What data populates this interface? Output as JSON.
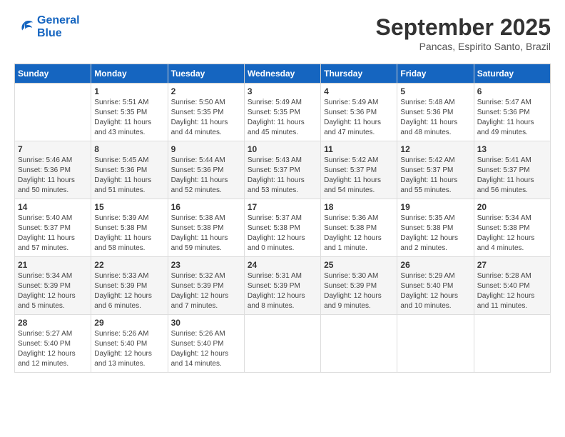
{
  "header": {
    "logo_line1": "General",
    "logo_line2": "Blue",
    "month_title": "September 2025",
    "location": "Pancas, Espirito Santo, Brazil"
  },
  "calendar": {
    "days_of_week": [
      "Sunday",
      "Monday",
      "Tuesday",
      "Wednesday",
      "Thursday",
      "Friday",
      "Saturday"
    ],
    "weeks": [
      [
        {
          "day": "",
          "info": ""
        },
        {
          "day": "1",
          "info": "Sunrise: 5:51 AM\nSunset: 5:35 PM\nDaylight: 11 hours\nand 43 minutes."
        },
        {
          "day": "2",
          "info": "Sunrise: 5:50 AM\nSunset: 5:35 PM\nDaylight: 11 hours\nand 44 minutes."
        },
        {
          "day": "3",
          "info": "Sunrise: 5:49 AM\nSunset: 5:35 PM\nDaylight: 11 hours\nand 45 minutes."
        },
        {
          "day": "4",
          "info": "Sunrise: 5:49 AM\nSunset: 5:36 PM\nDaylight: 11 hours\nand 47 minutes."
        },
        {
          "day": "5",
          "info": "Sunrise: 5:48 AM\nSunset: 5:36 PM\nDaylight: 11 hours\nand 48 minutes."
        },
        {
          "day": "6",
          "info": "Sunrise: 5:47 AM\nSunset: 5:36 PM\nDaylight: 11 hours\nand 49 minutes."
        }
      ],
      [
        {
          "day": "7",
          "info": "Sunrise: 5:46 AM\nSunset: 5:36 PM\nDaylight: 11 hours\nand 50 minutes."
        },
        {
          "day": "8",
          "info": "Sunrise: 5:45 AM\nSunset: 5:36 PM\nDaylight: 11 hours\nand 51 minutes."
        },
        {
          "day": "9",
          "info": "Sunrise: 5:44 AM\nSunset: 5:36 PM\nDaylight: 11 hours\nand 52 minutes."
        },
        {
          "day": "10",
          "info": "Sunrise: 5:43 AM\nSunset: 5:37 PM\nDaylight: 11 hours\nand 53 minutes."
        },
        {
          "day": "11",
          "info": "Sunrise: 5:42 AM\nSunset: 5:37 PM\nDaylight: 11 hours\nand 54 minutes."
        },
        {
          "day": "12",
          "info": "Sunrise: 5:42 AM\nSunset: 5:37 PM\nDaylight: 11 hours\nand 55 minutes."
        },
        {
          "day": "13",
          "info": "Sunrise: 5:41 AM\nSunset: 5:37 PM\nDaylight: 11 hours\nand 56 minutes."
        }
      ],
      [
        {
          "day": "14",
          "info": "Sunrise: 5:40 AM\nSunset: 5:37 PM\nDaylight: 11 hours\nand 57 minutes."
        },
        {
          "day": "15",
          "info": "Sunrise: 5:39 AM\nSunset: 5:38 PM\nDaylight: 11 hours\nand 58 minutes."
        },
        {
          "day": "16",
          "info": "Sunrise: 5:38 AM\nSunset: 5:38 PM\nDaylight: 11 hours\nand 59 minutes."
        },
        {
          "day": "17",
          "info": "Sunrise: 5:37 AM\nSunset: 5:38 PM\nDaylight: 12 hours\nand 0 minutes."
        },
        {
          "day": "18",
          "info": "Sunrise: 5:36 AM\nSunset: 5:38 PM\nDaylight: 12 hours\nand 1 minute."
        },
        {
          "day": "19",
          "info": "Sunrise: 5:35 AM\nSunset: 5:38 PM\nDaylight: 12 hours\nand 2 minutes."
        },
        {
          "day": "20",
          "info": "Sunrise: 5:34 AM\nSunset: 5:38 PM\nDaylight: 12 hours\nand 4 minutes."
        }
      ],
      [
        {
          "day": "21",
          "info": "Sunrise: 5:34 AM\nSunset: 5:39 PM\nDaylight: 12 hours\nand 5 minutes."
        },
        {
          "day": "22",
          "info": "Sunrise: 5:33 AM\nSunset: 5:39 PM\nDaylight: 12 hours\nand 6 minutes."
        },
        {
          "day": "23",
          "info": "Sunrise: 5:32 AM\nSunset: 5:39 PM\nDaylight: 12 hours\nand 7 minutes."
        },
        {
          "day": "24",
          "info": "Sunrise: 5:31 AM\nSunset: 5:39 PM\nDaylight: 12 hours\nand 8 minutes."
        },
        {
          "day": "25",
          "info": "Sunrise: 5:30 AM\nSunset: 5:39 PM\nDaylight: 12 hours\nand 9 minutes."
        },
        {
          "day": "26",
          "info": "Sunrise: 5:29 AM\nSunset: 5:40 PM\nDaylight: 12 hours\nand 10 minutes."
        },
        {
          "day": "27",
          "info": "Sunrise: 5:28 AM\nSunset: 5:40 PM\nDaylight: 12 hours\nand 11 minutes."
        }
      ],
      [
        {
          "day": "28",
          "info": "Sunrise: 5:27 AM\nSunset: 5:40 PM\nDaylight: 12 hours\nand 12 minutes."
        },
        {
          "day": "29",
          "info": "Sunrise: 5:26 AM\nSunset: 5:40 PM\nDaylight: 12 hours\nand 13 minutes."
        },
        {
          "day": "30",
          "info": "Sunrise: 5:26 AM\nSunset: 5:40 PM\nDaylight: 12 hours\nand 14 minutes."
        },
        {
          "day": "",
          "info": ""
        },
        {
          "day": "",
          "info": ""
        },
        {
          "day": "",
          "info": ""
        },
        {
          "day": "",
          "info": ""
        }
      ]
    ]
  }
}
